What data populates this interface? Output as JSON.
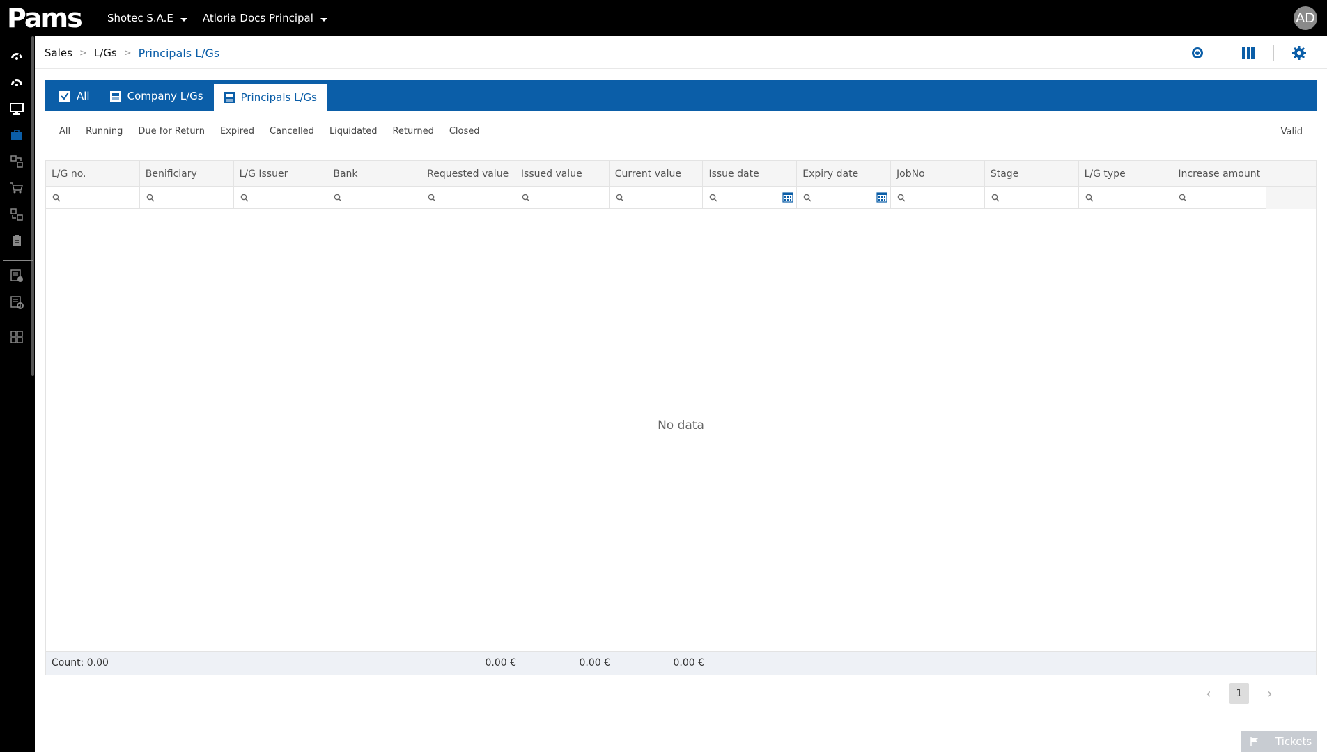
{
  "app": {
    "logo_text": "Pams",
    "avatar_initials": "AD"
  },
  "topbar": {
    "company_selector": "Shotec S.A.E",
    "principal_selector": "Atloria Docs Principal"
  },
  "sidebar": {
    "icons": [
      "dashboard-icon",
      "dashboard-icon",
      "monitor-icon",
      "briefcase-icon",
      "transfer-icon",
      "cart-icon",
      "transfer-icon",
      "clipboard-icon",
      "list-check-icon",
      "list-gear-icon",
      "grid-icon"
    ]
  },
  "breadcrumb": {
    "level1": "Sales",
    "level2": "L/Gs",
    "current": "Principals L/Gs"
  },
  "top_actions": [
    "refresh-icon",
    "columns-icon",
    "settings-icon"
  ],
  "tabs": [
    {
      "label": "All",
      "icon": "checkbox-icon",
      "active": false
    },
    {
      "label": "Company L/Gs",
      "icon": "company-doc-icon",
      "active": false
    },
    {
      "label": "Principals L/Gs",
      "icon": "principal-doc-icon",
      "active": true
    }
  ],
  "status_filters": [
    "All",
    "Running",
    "Due for Return",
    "Expired",
    "Cancelled",
    "Liquidated",
    "Returned",
    "Closed"
  ],
  "status_filter_right": "Valid",
  "grid": {
    "columns": [
      "L/G no.",
      "Benificiary",
      "L/G Issuer",
      "Bank",
      "Requested value",
      "Issued value",
      "Current value",
      "Issue date",
      "Expiry date",
      "JobNo",
      "Stage",
      "L/G type",
      "Increase amount"
    ],
    "date_columns": [
      7,
      8
    ],
    "empty_text": "No data",
    "footer": {
      "count": "Count: 0.00",
      "requested_sum": "0.00 €",
      "issued_sum": "0.00 €",
      "current_sum": "0.00 €"
    }
  },
  "pager": {
    "current_page": "1"
  },
  "tickets": {
    "label": "Tickets"
  },
  "colors": {
    "primary": "#0b5ea8",
    "topbar": "#000000"
  }
}
